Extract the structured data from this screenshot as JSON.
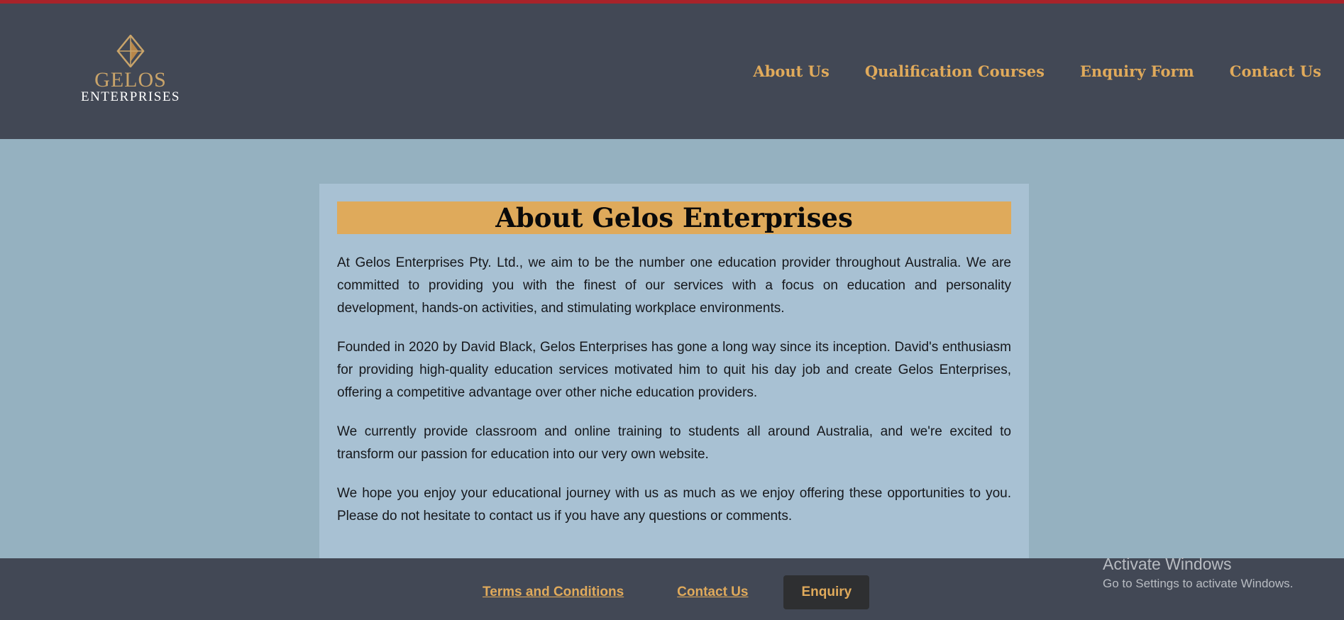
{
  "brand": {
    "name": "GELOS",
    "sub": "ENTERPRISES",
    "logo_icon": "diamond-logo-icon"
  },
  "nav": {
    "items": [
      {
        "label": "About Us"
      },
      {
        "label": "Qualification Courses"
      },
      {
        "label": "Enquiry Form"
      },
      {
        "label": "Contact Us"
      }
    ]
  },
  "main": {
    "title": "About Gelos Enterprises",
    "paragraphs": [
      "At Gelos Enterprises Pty. Ltd., we aim to be the number one education provider throughout Australia. We are committed to providing you with the finest of our services with a focus on education and personality development, hands-on activities, and stimulating workplace environments.",
      "Founded in 2020 by David Black, Gelos Enterprises has gone a long way since its inception. David's enthusiasm for providing high-quality education services motivated him to quit his day job and create Gelos Enterprises, offering a competitive advantage over other niche education providers.",
      "We currently provide classroom and online training to students all around Australia, and we're excited to transform our passion for education into our very own website.",
      "We hope you enjoy your educational journey with us as much as we enjoy offering these opportunities to you. Please do not hesitate to contact us if you have any questions or comments."
    ]
  },
  "footer": {
    "terms_label": "Terms and Conditions",
    "contact_label": "Contact Us",
    "enquiry_label": "Enquiry"
  },
  "watermark": {
    "line1": "Activate Windows",
    "line2": "Go to Settings to activate Windows."
  },
  "colors": {
    "accent": "#dfaa5b",
    "header_bg": "#424855",
    "page_bg": "#95b1c0",
    "card_bg": "#a8c1d3",
    "top_stripe": "#a8232a"
  }
}
